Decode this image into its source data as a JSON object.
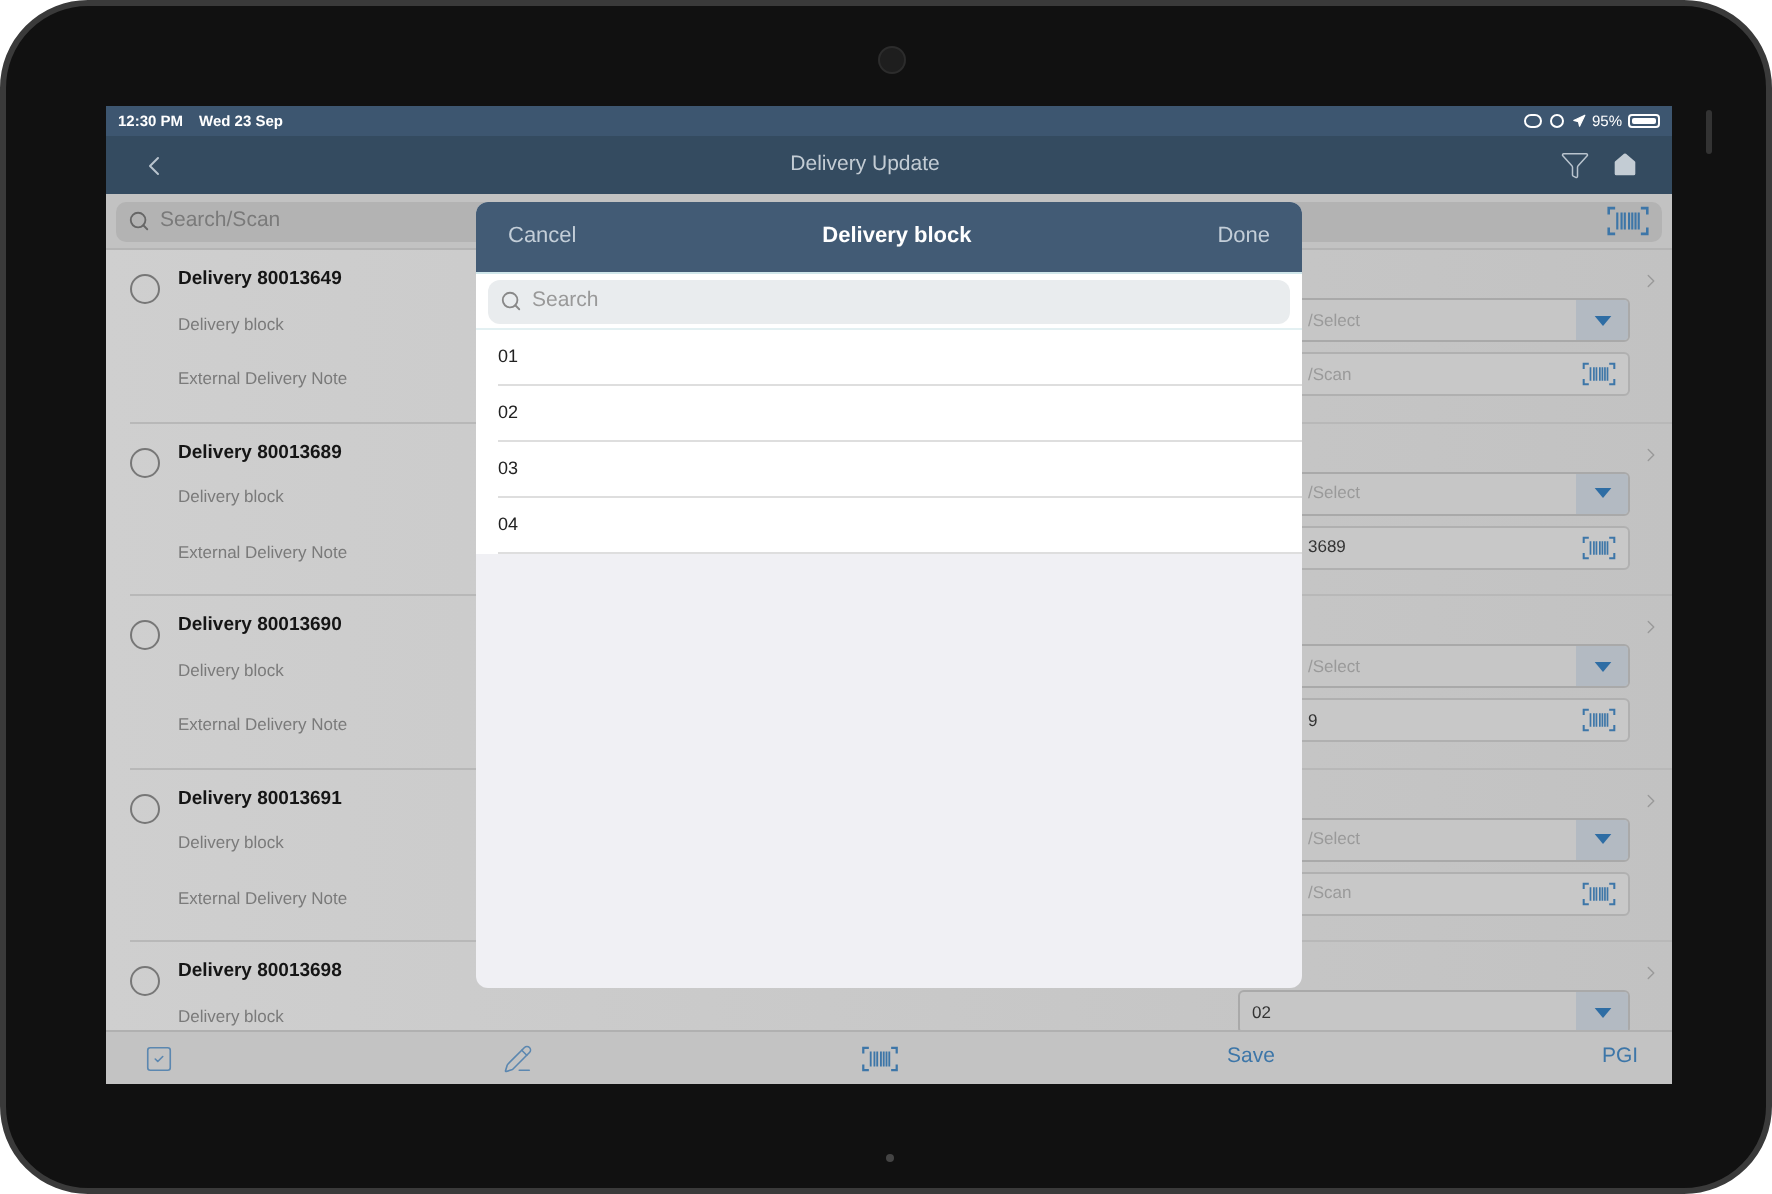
{
  "status_bar": {
    "time": "12:30 PM",
    "date": "Wed 23 Sep",
    "battery": "95%"
  },
  "nav_bar": {
    "title": "Delivery Update"
  },
  "search": {
    "placeholder": "Search/Scan"
  },
  "deliveries": [
    {
      "title": "Delivery 80013649",
      "selected": false,
      "block_label": "Delivery block",
      "note_label": "External Delivery Note",
      "block_field": {
        "placeholder": "/Select"
      },
      "note_field": {
        "placeholder": "/Scan"
      }
    },
    {
      "title": "Delivery 80013689",
      "selected": false,
      "block_label": "Delivery block",
      "note_label": "External Delivery Note",
      "block_field": {
        "placeholder": "/Select"
      },
      "note_field": {
        "value": "3689"
      }
    },
    {
      "title": "Delivery 80013690",
      "selected": false,
      "block_label": "Delivery block",
      "note_label": "External Delivery Note",
      "block_field": {
        "placeholder": "/Select"
      },
      "note_field": {
        "value": "9"
      }
    },
    {
      "title": "Delivery 80013691",
      "selected": false,
      "block_label": "Delivery block",
      "note_label": "External Delivery Note",
      "block_field": {
        "placeholder": "/Select"
      },
      "note_field": {
        "placeholder": "/Scan"
      }
    },
    {
      "title": "Delivery 80013698",
      "selected": false,
      "block_label": "Delivery block",
      "block_field": {
        "value": "02"
      }
    }
  ],
  "toolbar": {
    "save": "Save",
    "pgi": "PGI"
  },
  "picker": {
    "cancel": "Cancel",
    "title": "Delivery block",
    "done": "Done",
    "search_placeholder": "Search",
    "options": [
      "01",
      "02",
      "03",
      "04"
    ]
  }
}
